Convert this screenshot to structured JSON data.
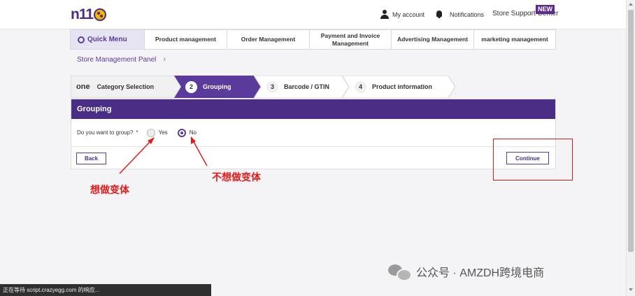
{
  "header": {
    "logo": "n11",
    "my_account": "My account",
    "notifications": "Notifications",
    "store_support": "Store Support Center",
    "new_badge": "NEW"
  },
  "menu": {
    "quick_menu": "Quick Menu",
    "items": [
      {
        "label": "Product management"
      },
      {
        "label": "Order Management"
      },
      {
        "label": "Payment and Invoice Management"
      },
      {
        "label": "Advertising Management"
      },
      {
        "label": "marketing management"
      }
    ]
  },
  "breadcrumb": {
    "label": "Store Management Panel",
    "chevron": "›"
  },
  "steps": [
    {
      "num": "one",
      "label": "Category Selection"
    },
    {
      "num": "2",
      "label": "Grouping",
      "active": true
    },
    {
      "num": "3",
      "label": "Barcode / GTIN"
    },
    {
      "num": "4",
      "label": "Product information"
    }
  ],
  "panel": {
    "title": "Grouping",
    "question": "Do you want to group?",
    "required_mark": "*",
    "options": [
      {
        "label": "Yes",
        "checked": false
      },
      {
        "label": "No",
        "checked": true
      }
    ],
    "back_label": "Back",
    "continue_label": "Continue"
  },
  "annotations": {
    "want_variant": "想做变体",
    "no_variant": "不想做变体"
  },
  "watermark": "公众号 · AMZDH跨境电商",
  "status_bar": "正在等待 script.crazyegg.com 的响应...",
  "colors": {
    "brand_purple": "#4a2e86",
    "annotation_red": "#e31b1b"
  }
}
